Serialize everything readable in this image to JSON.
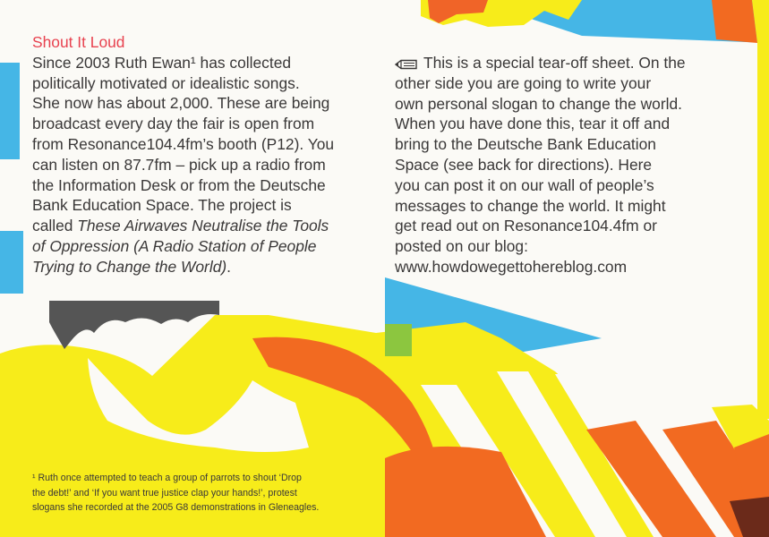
{
  "left": {
    "title": "Shout It Loud",
    "lines": [
      "Since 2003 Ruth Ewan¹ has collected",
      "politically motivated or idealistic songs.",
      "She now has about 2,000. These are being",
      "broadcast every day the fair is open from",
      "from Resonance104.4fm’s booth (P12). You",
      "can listen on 87.7fm – pick up a radio from",
      "the Information Desk or from the Deutsche",
      "Bank Education Space. The project is",
      "called "
    ],
    "italic_lines": [
      "These Airwaves Neutralise the Tools",
      "of Oppression (A Radio Station of People",
      "Trying to Change the World)"
    ],
    "end_punct": "."
  },
  "right": {
    "icon": "pencil-icon",
    "lines": [
      "This is a special tear-off sheet. On the",
      "other side you are going to write your",
      "own personal slogan to change the world.",
      "When you have done this, tear it off and",
      "bring to the Deutsche Bank Education",
      "Space (see back for directions). Here",
      "you can post it on our wall of people’s",
      "messages to change the world. It might",
      "get read out on Resonance104.4fm or",
      "posted on our blog:",
      "www.howdowegettohereblog.com"
    ]
  },
  "footnote": {
    "marker": "¹",
    "lines": [
      "Ruth once attempted to teach a group of parrots to shout ‘Drop",
      "the debt!’ and ‘If you want true justice clap your hands!’, protest",
      "slogans she recorded at the 2005 G8 demonstrations in Gleneagles."
    ]
  },
  "colors": {
    "yellow": "#f7ec1a",
    "orange": "#f26a21",
    "blue": "#45b6e6",
    "gray": "#555555",
    "red_text": "#e8424f"
  }
}
